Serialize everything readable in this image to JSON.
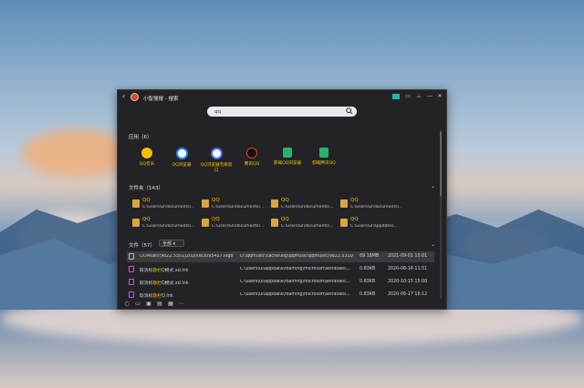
{
  "window": {
    "title": "小智搜搜 - 搜索",
    "controls": [
      "tile-icon",
      "settings-icon",
      "pin-icon",
      "minimize-icon",
      "close-icon"
    ]
  },
  "search": {
    "value": "qq",
    "placeholder": ""
  },
  "apps": {
    "title": "应用（6）",
    "items": [
      {
        "label": "QQ音乐",
        "icon": "qq-music-icon",
        "color": "#f2c000"
      },
      {
        "label": "QQ浏览器",
        "icon": "qq-browser-icon",
        "color": "#1d8cff"
      },
      {
        "label": "QQ浏览器无痕窗口",
        "icon": "qq-browser-private-icon",
        "color": "#3b6ef4"
      },
      {
        "label": "腾讯QQ",
        "icon": "qq-penguin-icon",
        "color": "#111111"
      },
      {
        "label": "卸载QQ浏览器",
        "icon": "uninstall-icon",
        "color": "#2bb36b"
      },
      {
        "label": "卸载腾讯QQ",
        "icon": "uninstall-icon",
        "color": "#2bb36b"
      }
    ]
  },
  "folders": {
    "title": "文件夹（143）",
    "items": [
      {
        "name": "QQ",
        "path": "C:\\users\\ul\\documents\\..."
      },
      {
        "name": "QQ",
        "path": "C:\\users\\ul\\documents\\..."
      },
      {
        "name": "QQ",
        "path": "C:\\users\\ul\\documents\\..."
      },
      {
        "name": "QQ",
        "path": "C:\\users\\ul\\documents\\..."
      },
      {
        "name": "QQ",
        "path": "C:\\users\\ul\\documents\\..."
      },
      {
        "name": "QQ",
        "path": "C:\\users\\ul\\documents\\..."
      },
      {
        "name": "QQ",
        "path": "C:\\users\\ul\\documents\\..."
      },
      {
        "name": "QQ",
        "path": "C:\\users\\ul\\appdates..."
      }
    ]
  },
  "files": {
    "title": "文件（57）",
    "filter": "全部",
    "rows": [
      {
        "prefix": "",
        "highlight": "QQ",
        "suffix": "Music(9822.5351)2020083095417.log8",
        "path": "D:\\qqmusic\\cache\\log\\qqmusic\\qqmusic(9822.531D...",
        "size": "69.18MB",
        "date": "2021-09-01 10:01"
      },
      {
        "prefix": "取消标",
        "highlight": "题栏",
        "suffix": "Q模式.xd.lnk",
        "path": "C:\\users\\ul\\appdata\\roaming\\microsoft\\windows\\...",
        "size": "0.83KB",
        "date": "2020-06-16 11:51"
      },
      {
        "prefix": "取消标",
        "highlight": "题栏",
        "suffix": "Q模式.xd.lnk",
        "path": "C:\\users\\ul\\appdata\\roaming\\microsoft\\windows\\...",
        "size": "0.83KB",
        "date": "2020-10-15 15:00"
      },
      {
        "prefix": "取消标",
        "highlight": "题栏",
        "suffix": "Q.lnk",
        "path": "C:\\users\\ul\\appdata\\roaming\\microsoft\\windows\\...",
        "size": "0.83KB",
        "date": "2020-06-17 16:12"
      }
    ]
  },
  "bottom_icons": [
    "circle-icon",
    "monitor-icon",
    "image-icon",
    "layout-icon",
    "photo-icon",
    "more-icon"
  ]
}
